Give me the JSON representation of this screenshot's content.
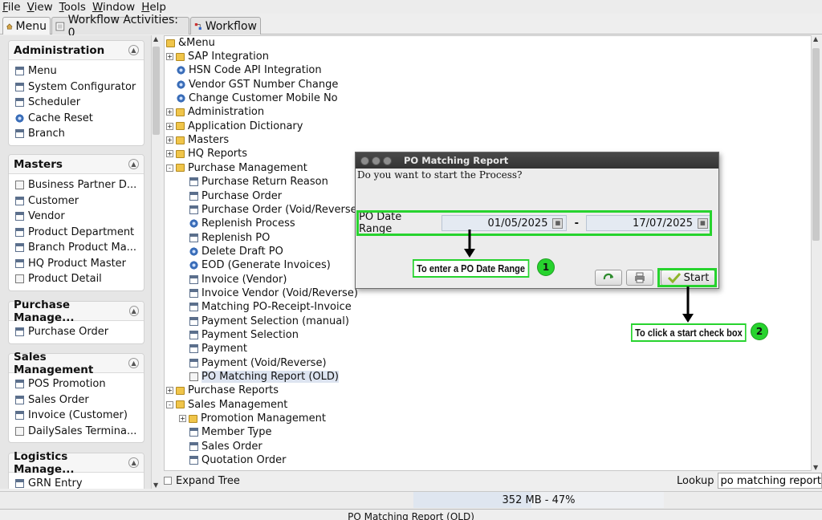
{
  "menubar": [
    "File",
    "View",
    "Tools",
    "Window",
    "Help"
  ],
  "tabs": [
    {
      "label": "Menu"
    },
    {
      "label": "Workflow Activities: 0"
    },
    {
      "label": "Workflow"
    }
  ],
  "sidebar": {
    "groups": [
      {
        "title": "Administration",
        "items": [
          {
            "label": "Menu",
            "icon": "window-icon"
          },
          {
            "label": "System Configurator",
            "icon": "window-icon"
          },
          {
            "label": "Scheduler",
            "icon": "window-icon"
          },
          {
            "label": "Cache Reset",
            "icon": "process-icon"
          },
          {
            "label": "Branch",
            "icon": "window-icon"
          }
        ]
      },
      {
        "title": "Masters",
        "items": [
          {
            "label": "Business Partner D...",
            "icon": "form-icon"
          },
          {
            "label": "Customer",
            "icon": "window-icon"
          },
          {
            "label": "Vendor",
            "icon": "window-icon"
          },
          {
            "label": "Product Department",
            "icon": "window-icon"
          },
          {
            "label": "Branch Product Ma...",
            "icon": "window-icon"
          },
          {
            "label": "HQ Product Master",
            "icon": "window-icon"
          },
          {
            "label": "Product Detail",
            "icon": "form-icon"
          }
        ]
      },
      {
        "title": "Purchase Manage...",
        "items": [
          {
            "label": "Purchase Order",
            "icon": "window-icon"
          }
        ]
      },
      {
        "title": "Sales Management",
        "items": [
          {
            "label": "POS Promotion",
            "icon": "window-icon"
          },
          {
            "label": "Sales Order",
            "icon": "window-icon"
          },
          {
            "label": "Invoice (Customer)",
            "icon": "window-icon"
          },
          {
            "label": "DailySales Termina...",
            "icon": "form-icon"
          }
        ]
      },
      {
        "title": "Logistics Manage...",
        "items": [
          {
            "label": "GRN Entry",
            "icon": "window-icon"
          }
        ]
      }
    ]
  },
  "tree": {
    "root": "&Menu",
    "rows": [
      {
        "label": "SAP Integration",
        "type": "folder",
        "expander": "+",
        "level": 1
      },
      {
        "label": "HSN Code API Integration",
        "type": "process",
        "level": 1
      },
      {
        "label": "Vendor GST Number Change",
        "type": "process",
        "level": 1
      },
      {
        "label": "Change Customer Mobile No",
        "type": "process",
        "level": 1
      },
      {
        "label": "Administration",
        "type": "folder",
        "expander": "+",
        "level": 1
      },
      {
        "label": "Application Dictionary",
        "type": "folder",
        "expander": "+",
        "level": 1
      },
      {
        "label": "Masters",
        "type": "folder",
        "expander": "+",
        "level": 1
      },
      {
        "label": "HQ Reports",
        "type": "folder",
        "expander": "+",
        "level": 1
      },
      {
        "label": "Purchase Management",
        "type": "folder-open",
        "expander": "-",
        "level": 1
      },
      {
        "label": "Purchase Return Reason",
        "type": "window",
        "level": 2
      },
      {
        "label": "Purchase Order",
        "type": "window",
        "level": 2
      },
      {
        "label": "Purchase Order (Void/Reverse)",
        "type": "window",
        "level": 2
      },
      {
        "label": "Replenish Process",
        "type": "process",
        "level": 2
      },
      {
        "label": "Replenish PO",
        "type": "window",
        "level": 2
      },
      {
        "label": "Delete Draft PO",
        "type": "process",
        "level": 2
      },
      {
        "label": "EOD (Generate Invoices)",
        "type": "process",
        "level": 2
      },
      {
        "label": "Invoice (Vendor)",
        "type": "window",
        "level": 2
      },
      {
        "label": "Invoice Vendor (Void/Reverse)",
        "type": "window",
        "level": 2
      },
      {
        "label": "Matching PO-Receipt-Invoice",
        "type": "window",
        "level": 2
      },
      {
        "label": "Payment Selection (manual)",
        "type": "window",
        "level": 2
      },
      {
        "label": "Payment Selection",
        "type": "window",
        "level": 2
      },
      {
        "label": "Payment",
        "type": "window",
        "level": 2
      },
      {
        "label": "Payment (Void/Reverse)",
        "type": "window",
        "level": 2
      },
      {
        "label": "PO Matching Report (OLD)",
        "type": "form",
        "level": 2,
        "selected": true
      },
      {
        "label": "Purchase Reports",
        "type": "folder",
        "expander": "+",
        "level": 1
      },
      {
        "label": "Sales Management",
        "type": "folder-open",
        "expander": "-",
        "level": 1
      },
      {
        "label": "Promotion Management",
        "type": "folder",
        "expander": "+",
        "level": 2
      },
      {
        "label": "Member Type",
        "type": "window",
        "level": 2
      },
      {
        "label": "Sales Order",
        "type": "window",
        "level": 2
      },
      {
        "label": "Quotation Order",
        "type": "window",
        "level": 2
      }
    ]
  },
  "expand_tree": {
    "label": "Expand Tree",
    "checked": false
  },
  "lookup": {
    "label": "Lookup",
    "value": "po matching report"
  },
  "memory": {
    "text": "352 MB - 47%",
    "percent": 47
  },
  "footer": {
    "text": "PO Matching Report (OLD)"
  },
  "dialog": {
    "title": "PO Matching Report",
    "question": "Do you want to start the Process?",
    "param_label": "PO Date Range",
    "date_from": "01/05/2025",
    "date_to": "17/07/2025",
    "separator": "-",
    "start_label": "Start"
  },
  "annotations": [
    {
      "text": "To enter a PO Date Range",
      "number": "1"
    },
    {
      "text": "To click a start check box",
      "number": "2"
    }
  ],
  "colors": {
    "highlight": "#27d32e",
    "selection": "#dde4f0",
    "folder": "#f0c54a"
  }
}
